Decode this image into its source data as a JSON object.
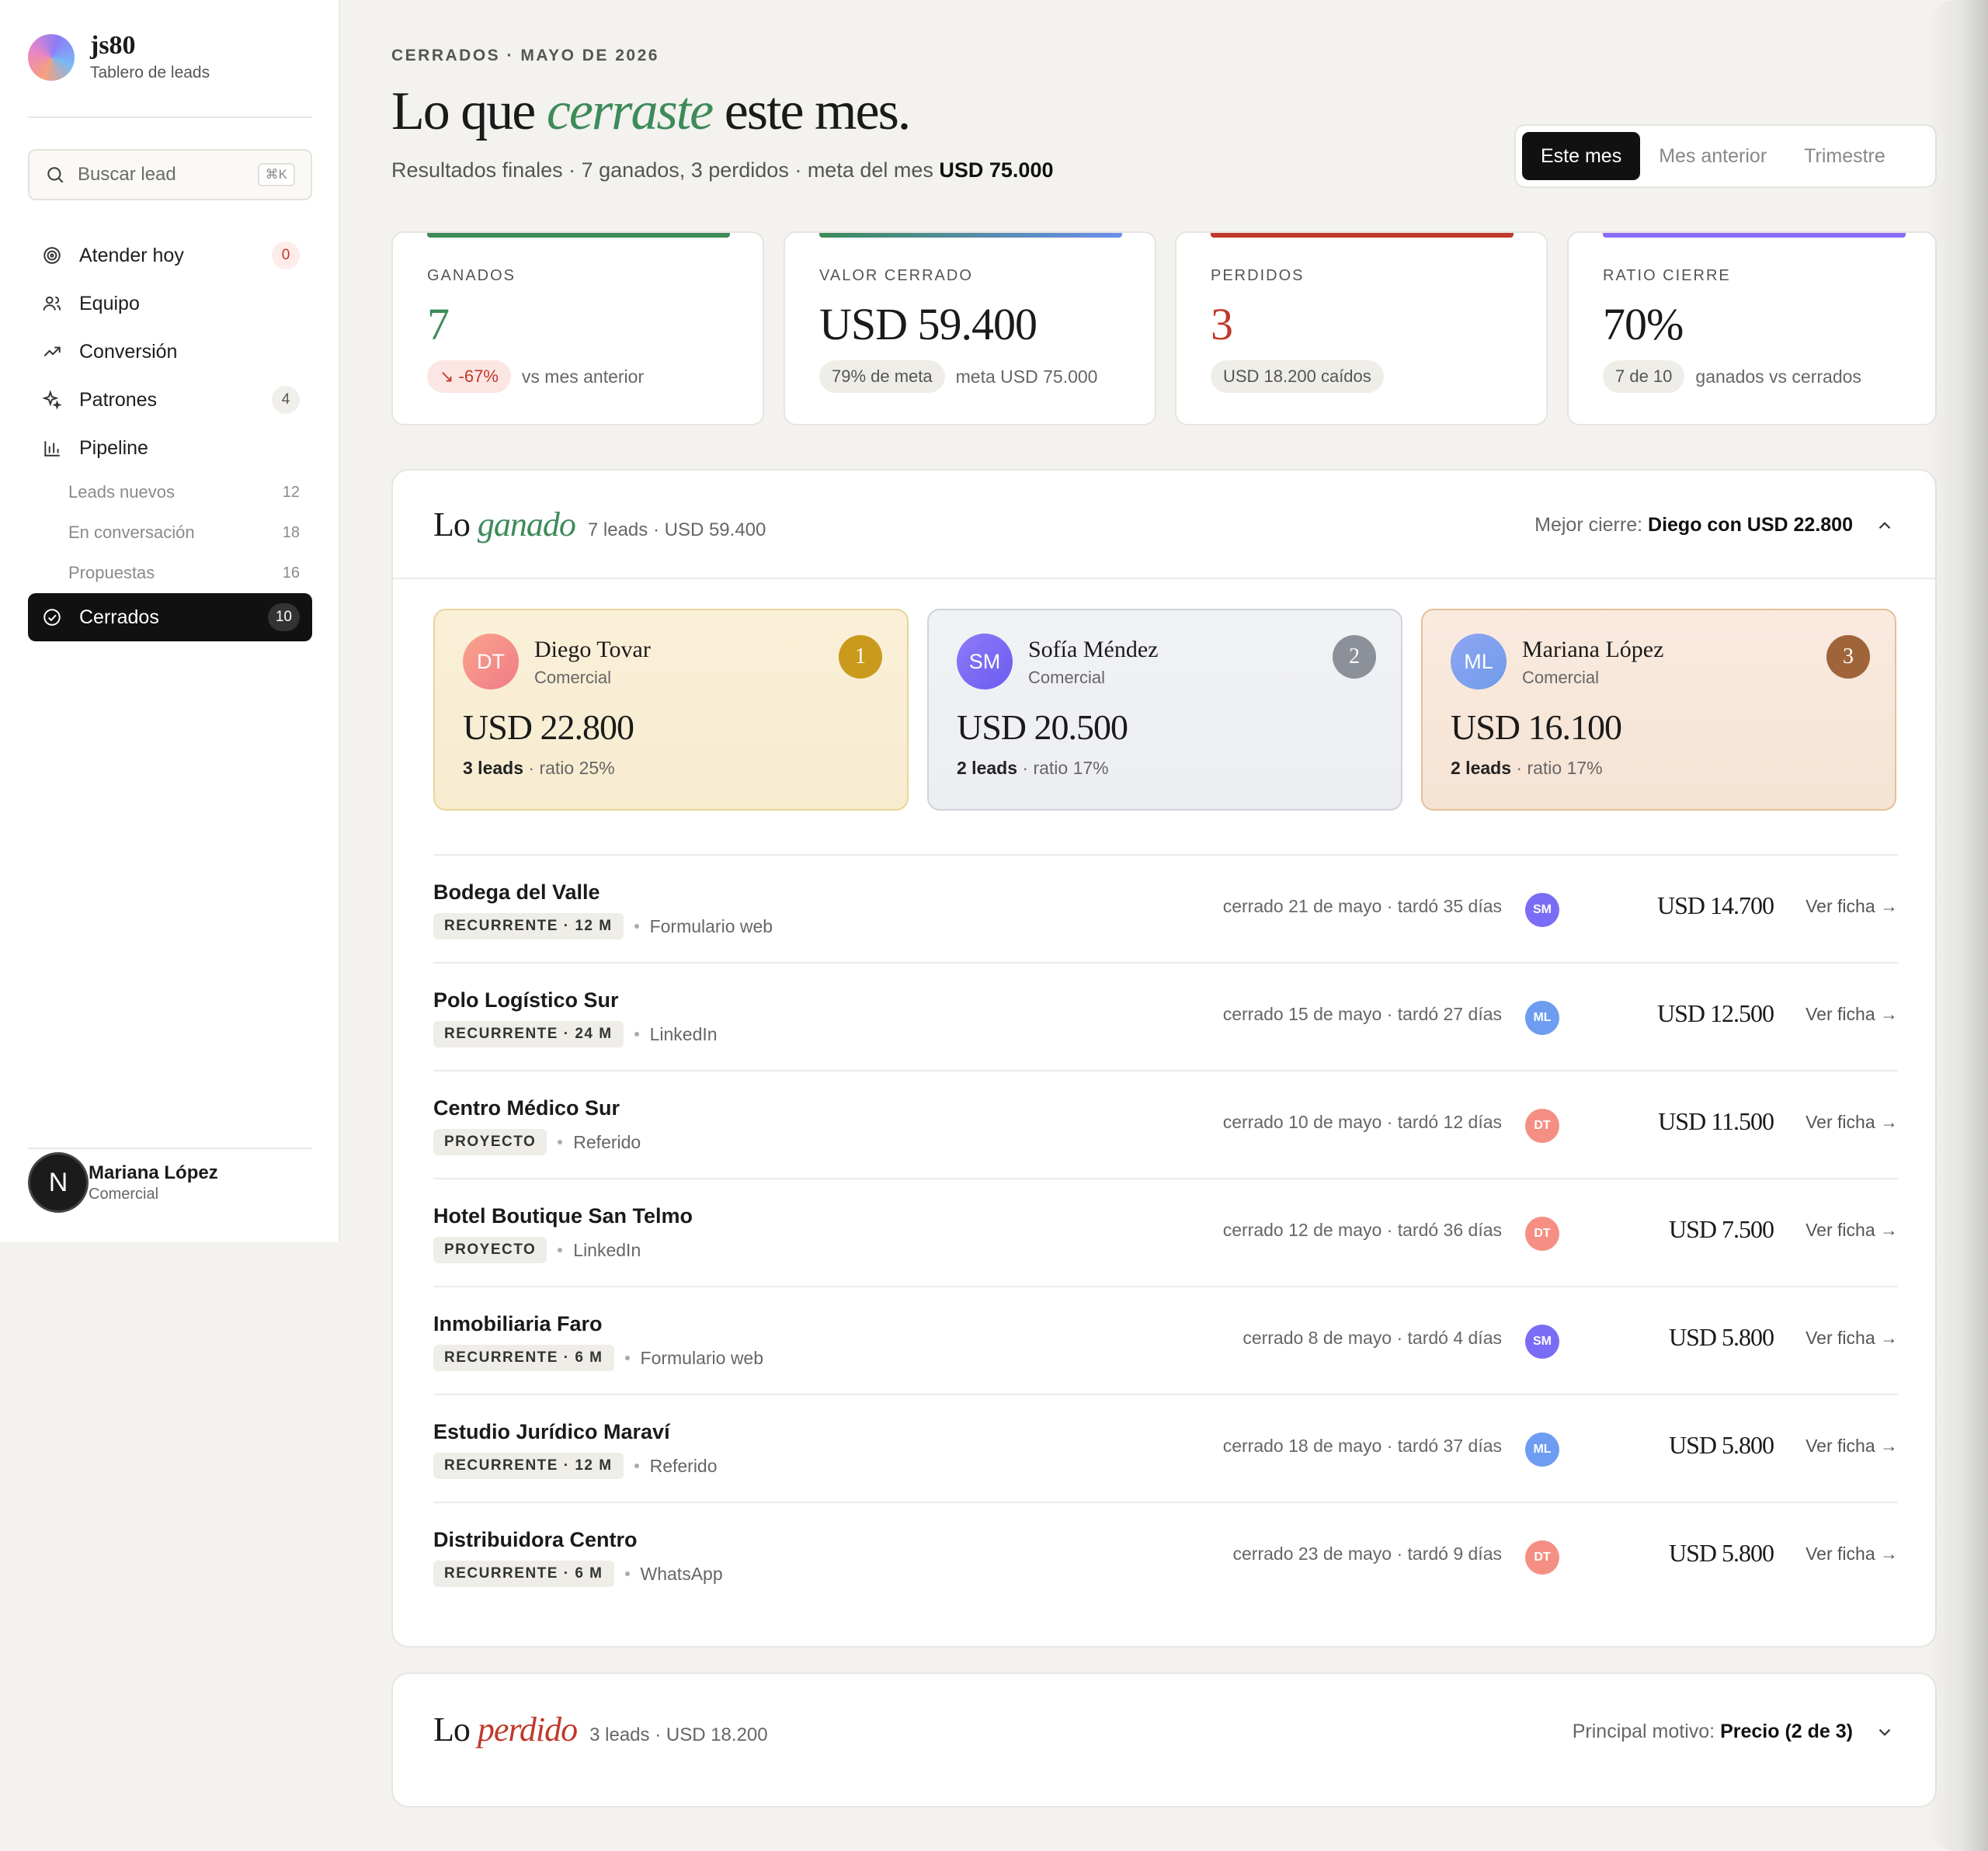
{
  "brand": {
    "name": "js80",
    "subtitle": "Tablero de leads"
  },
  "search": {
    "placeholder": "Buscar lead",
    "shortcut": "⌘K"
  },
  "nav": {
    "items": [
      {
        "label": "Atender hoy",
        "badge": "0",
        "icon": "target-icon"
      },
      {
        "label": "Equipo",
        "badge": "",
        "icon": "users-icon"
      },
      {
        "label": "Conversión",
        "badge": "",
        "icon": "trend-up-icon"
      },
      {
        "label": "Patrones",
        "badge": "4",
        "icon": "sparkle-icon"
      },
      {
        "label": "Pipeline",
        "badge": "",
        "icon": "bar-chart-icon"
      }
    ],
    "pipeline_sub": [
      {
        "label": "Leads nuevos",
        "count": "12"
      },
      {
        "label": "En conversación",
        "count": "18"
      },
      {
        "label": "Propuestas",
        "count": "16"
      }
    ],
    "active": {
      "label": "Cerrados",
      "badge": "10",
      "icon": "check-circle-icon"
    }
  },
  "user": {
    "initial": "N",
    "name": "Mariana López",
    "role": "Comercial"
  },
  "header": {
    "eyebrow": "CERRADOS · MAYO DE 2026",
    "title_pre": "Lo que ",
    "title_em": "cerraste",
    "title_post": " este mes.",
    "sub_text": "Resultados finales · 7 ganados, 3 perdidos · meta del mes ",
    "sub_bold": "USD 75.000"
  },
  "period": {
    "options": [
      "Este mes",
      "Mes anterior",
      "Trimestre"
    ],
    "selected": "Este mes"
  },
  "kpis": [
    {
      "label": "GANADOS",
      "value": "7",
      "pill": "↘ -67%",
      "note": "vs mes anterior",
      "color": "#3d8b59"
    },
    {
      "label": "VALOR CERRADO",
      "value": "USD 59.400",
      "pill": "79% de meta",
      "note": "meta USD 75.000",
      "color": "#111111"
    },
    {
      "label": "PERDIDOS",
      "value": "3",
      "pill": "USD 18.200 caídos",
      "note": "",
      "color": "#c0392b"
    },
    {
      "label": "RATIO CIERRE",
      "value": "70%",
      "pill": "7 de 10",
      "note": "ganados vs cerrados",
      "color": "#111111"
    }
  ],
  "won": {
    "title_pre": "Lo ",
    "title_em": "ganado",
    "meta": "7 leads · USD 59.400",
    "best_label": "Mejor cierre: ",
    "best_value": "Diego con USD 22.800",
    "top": [
      {
        "initials": "DT",
        "name": "Diego Tovar",
        "role": "Comercial",
        "rank": "1",
        "amount": "USD 22.800",
        "leads": "3 leads",
        "ratio": " · ratio 25%"
      },
      {
        "initials": "SM",
        "name": "Sofía Méndez",
        "role": "Comercial",
        "rank": "2",
        "amount": "USD 20.500",
        "leads": "2 leads",
        "ratio": " · ratio 17%"
      },
      {
        "initials": "ML",
        "name": "Mariana López",
        "role": "Comercial",
        "rank": "3",
        "amount": "USD 16.100",
        "leads": "2 leads",
        "ratio": " · ratio 17%"
      }
    ],
    "rows": [
      {
        "company": "Bodega del Valle",
        "tag": "RECURRENTE · 12 M",
        "source": "Formulario web",
        "when": "cerrado 21 de mayo · tardó 35 días",
        "owner": "SM",
        "amount": "USD 14.700",
        "link": "Ver ficha →"
      },
      {
        "company": "Polo Logístico Sur",
        "tag": "RECURRENTE · 24 M",
        "source": "LinkedIn",
        "when": "cerrado 15 de mayo · tardó 27 días",
        "owner": "ML",
        "amount": "USD 12.500",
        "link": "Ver ficha →"
      },
      {
        "company": "Centro Médico Sur",
        "tag": "PROYECTO",
        "source": "Referido",
        "when": "cerrado 10 de mayo · tardó 12 días",
        "owner": "DT",
        "amount": "USD 11.500",
        "link": "Ver ficha →"
      },
      {
        "company": "Hotel Boutique San Telmo",
        "tag": "PROYECTO",
        "source": "LinkedIn",
        "when": "cerrado 12 de mayo · tardó 36 días",
        "owner": "DT",
        "amount": "USD 7.500",
        "link": "Ver ficha →"
      },
      {
        "company": "Inmobiliaria Faro",
        "tag": "RECURRENTE · 6 M",
        "source": "Formulario web",
        "when": "cerrado 8 de mayo · tardó 4 días",
        "owner": "SM",
        "amount": "USD 5.800",
        "link": "Ver ficha →"
      },
      {
        "company": "Estudio Jurídico Maraví",
        "tag": "RECURRENTE · 12 M",
        "source": "Referido",
        "when": "cerrado 18 de mayo · tardó 37 días",
        "owner": "ML",
        "amount": "USD 5.800",
        "link": "Ver ficha →"
      },
      {
        "company": "Distribuidora Centro",
        "tag": "RECURRENTE · 6 M",
        "source": "WhatsApp",
        "when": "cerrado 23 de mayo · tardó 9 días",
        "owner": "DT",
        "amount": "USD 5.800",
        "link": "Ver ficha →"
      }
    ]
  },
  "lost": {
    "title_pre": "Lo ",
    "title_em": "perdido",
    "meta": "3 leads · USD 18.200",
    "reason_label": "Principal motivo: ",
    "reason_value": "Precio (2 de 3)"
  },
  "colors": {
    "won": "#3d8b59",
    "lost": "#c0392b",
    "DT": "#f58f84",
    "SM": "#7b6cf6",
    "ML": "#6d9cf0"
  }
}
